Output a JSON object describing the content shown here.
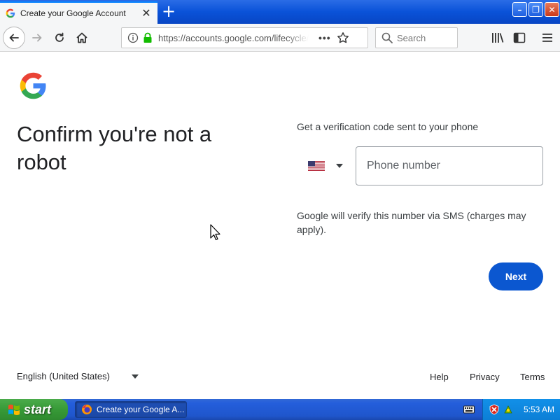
{
  "browser": {
    "tab_title": "Create your Google Account",
    "new_tab_label": "+",
    "url": "https://accounts.google.com/lifecycle/steps/signup",
    "search_placeholder": "Search"
  },
  "page": {
    "headline": "Confirm you're not a robot",
    "subtext": "Get a verification code sent to your phone",
    "country_code": "US",
    "phone_placeholder": "Phone number",
    "info_text": "Google will verify this number via SMS (charges may apply).",
    "next_label": "Next"
  },
  "footer": {
    "language": "English (United States)",
    "links": [
      "Help",
      "Privacy",
      "Terms"
    ]
  },
  "taskbar": {
    "start_label": "start",
    "task_label": "Create your Google A...",
    "clock": "5:53 AM"
  },
  "colors": {
    "primary_button": "#0b57d0",
    "xp_taskbar": "#245edb",
    "xp_start": "#379a37"
  },
  "icons": [
    "google-g-icon",
    "info-icon",
    "lock-icon",
    "star-icon",
    "search-icon",
    "library-icon",
    "sidebar-icon",
    "menu-icon",
    "us-flag-icon",
    "windows-flag-icon"
  ]
}
